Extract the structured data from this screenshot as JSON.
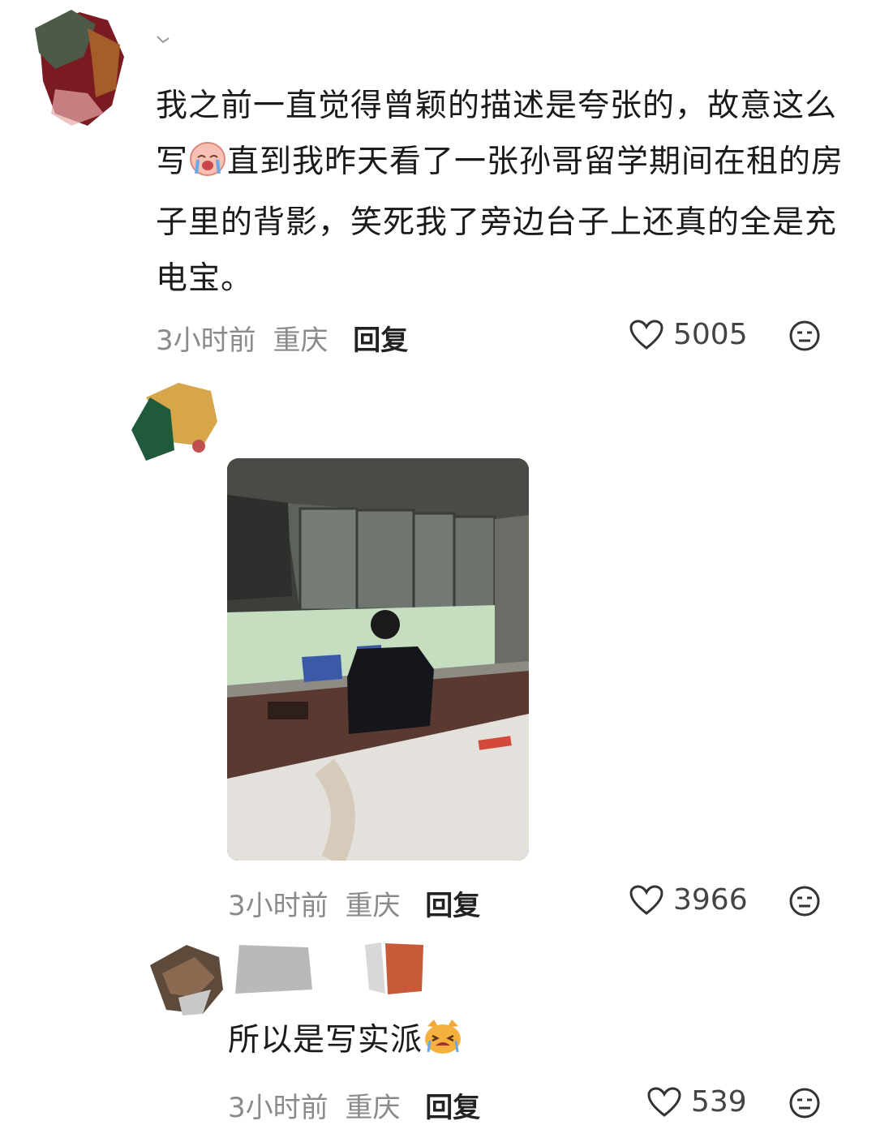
{
  "comments": [
    {
      "text": "我之前一直觉得曾颖的描述是夸张的，故意这么写",
      "text_after_emoji": "直到我昨天看了一张孙哥留学期间在租的房子里的背影，笑死我了旁边台子上还真的全是充电宝。",
      "emoji": "crying-face",
      "time": "3小时前",
      "location": "重庆",
      "reply_label": "回复",
      "likes": "5005"
    },
    {
      "image": "kitchen-photo",
      "time": "3小时前",
      "location": "重庆",
      "reply_label": "回复",
      "likes": "3966"
    },
    {
      "text": "所以是写实派",
      "emoji": "crying-cat",
      "time": "3小时前",
      "location": "重庆",
      "reply_label": "回复",
      "likes": "539"
    }
  ]
}
